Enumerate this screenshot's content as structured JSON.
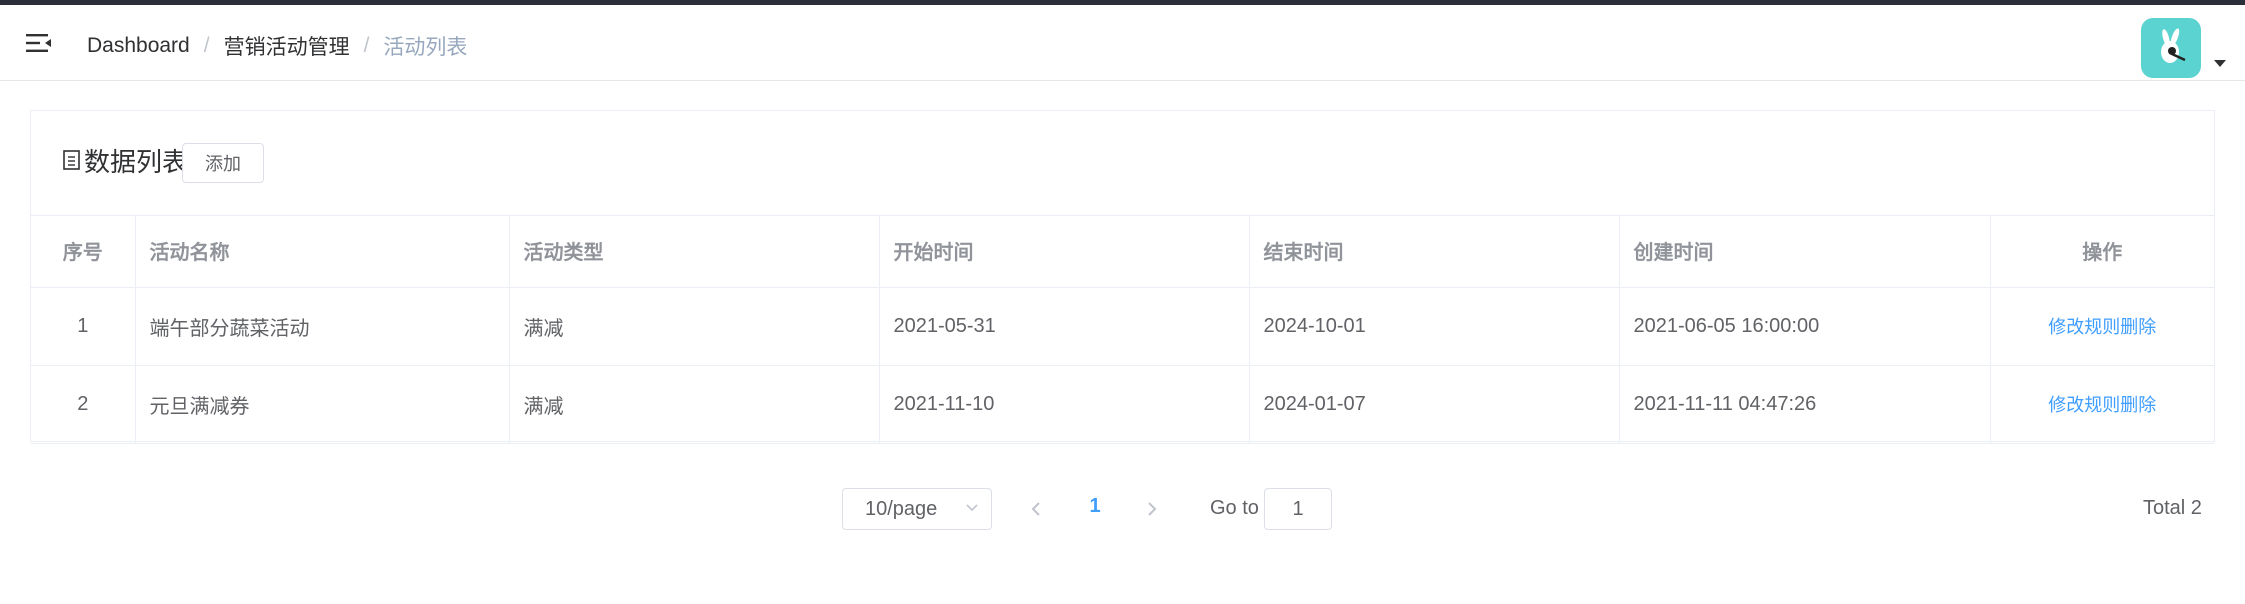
{
  "header": {
    "menu_icon": "hamburger-fold-icon",
    "breadcrumb": [
      {
        "label": "Dashboard"
      },
      {
        "label": "营销活动管理"
      },
      {
        "label": "活动列表"
      }
    ],
    "separator": "/",
    "avatar_icon": "user-avatar-icon",
    "avatar_color": "#5bd4d1"
  },
  "card": {
    "title_icon": "document-list-icon",
    "title": "数据列表",
    "add_label": "添加"
  },
  "table": {
    "columns": [
      "序号",
      "活动名称",
      "活动类型",
      "开始时间",
      "结束时间",
      "创建时间",
      "操作"
    ],
    "rows": [
      {
        "index": "1",
        "name": "端午部分蔬菜活动",
        "type": "满减",
        "start": "2021-05-31",
        "end": "2024-10-01",
        "created": "2021-06-05 16:00:00",
        "actions": [
          "修改",
          "规则",
          "删除"
        ]
      },
      {
        "index": "2",
        "name": "元旦满减券",
        "type": "满减",
        "start": "2021-11-10",
        "end": "2024-01-07",
        "created": "2021-11-11 04:47:26",
        "actions": [
          "修改",
          "规则",
          "删除"
        ]
      }
    ]
  },
  "pagination": {
    "page_size": "10/page",
    "current_page": "1",
    "goto_label": "Go to",
    "goto_value": "1",
    "total": "Total 2"
  },
  "colors": {
    "accent": "#409eff",
    "header_text": "#909399",
    "body_text": "#606266"
  }
}
